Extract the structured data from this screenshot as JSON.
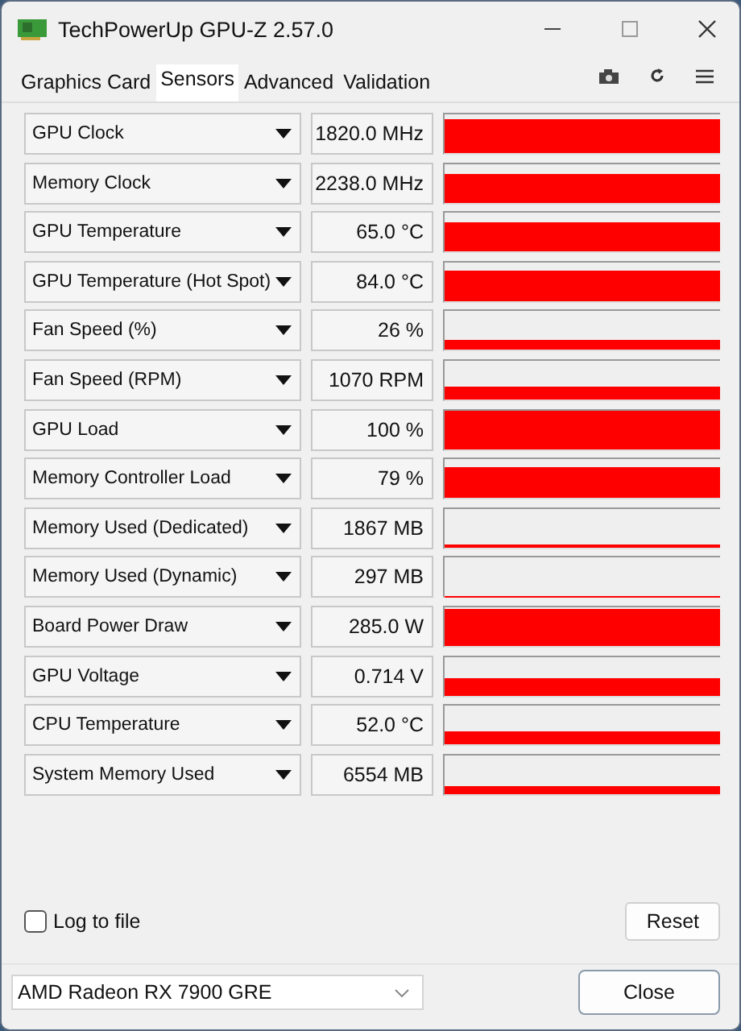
{
  "window": {
    "title": "TechPowerUp GPU-Z 2.57.0"
  },
  "tabs": [
    {
      "label": "Graphics Card",
      "selected": false
    },
    {
      "label": "Sensors",
      "selected": true
    },
    {
      "label": "Advanced",
      "selected": false
    },
    {
      "label": "Validation",
      "selected": false
    }
  ],
  "sensors": [
    {
      "name": "GPU Clock",
      "reading": "1820.0 MHz"
    },
    {
      "name": "Memory Clock",
      "reading": "2238.0 MHz"
    },
    {
      "name": "GPU Temperature",
      "reading": "65.0 °C"
    },
    {
      "name": "GPU Temperature (Hot Spot)",
      "reading": "84.0 °C"
    },
    {
      "name": "Fan Speed (%)",
      "reading": "26 %"
    },
    {
      "name": "Fan Speed (RPM)",
      "reading": "1070 RPM"
    },
    {
      "name": "GPU Load",
      "reading": "100 %"
    },
    {
      "name": "Memory Controller Load",
      "reading": "79 %"
    },
    {
      "name": "Memory Used (Dedicated)",
      "reading": "1867 MB"
    },
    {
      "name": "Memory Used (Dynamic)",
      "reading": "297 MB"
    },
    {
      "name": "Board Power Draw",
      "reading": "285.0 W"
    },
    {
      "name": "GPU Voltage",
      "reading": "0.714 V"
    },
    {
      "name": "CPU Temperature",
      "reading": "52.0 °C"
    },
    {
      "name": "System Memory Used",
      "reading": "6554 MB"
    }
  ],
  "log_to_file": {
    "label": "Log to file",
    "checked": false
  },
  "reset_button": "Reset",
  "device_select": {
    "value": "AMD Radeon RX 7900 GRE"
  },
  "close_button": "Close"
}
